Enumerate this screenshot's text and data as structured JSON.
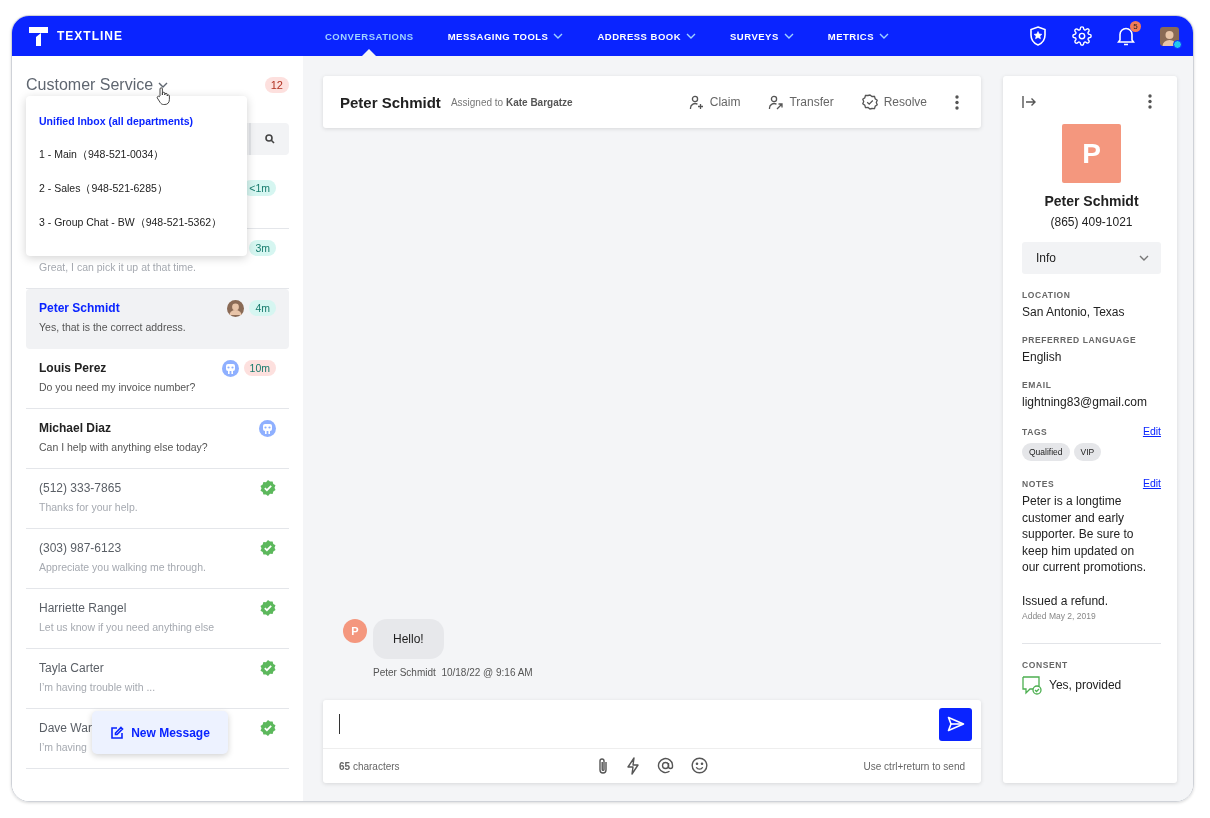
{
  "brand": "TEXTLINE",
  "nav": [
    {
      "label": "CONVERSATIONS",
      "selected": true,
      "has_menu": false
    },
    {
      "label": "MESSAGING TOOLS",
      "selected": false,
      "has_menu": true
    },
    {
      "label": "ADDRESS BOOK",
      "selected": false,
      "has_menu": true
    },
    {
      "label": "SURVEYS",
      "selected": false,
      "has_menu": true
    },
    {
      "label": "METRICS",
      "selected": false,
      "has_menu": true
    }
  ],
  "notifications": {
    "count": "5"
  },
  "user": {
    "online": true
  },
  "inbox": {
    "title": "Customer Service",
    "unread_count": "12",
    "menu": [
      {
        "label": "Unified Inbox (all departments)",
        "selected": true
      },
      {
        "label": "1 - Main（948-521-0034）",
        "selected": false
      },
      {
        "label": "2 - Sales（948-521-6285）",
        "selected": false
      },
      {
        "label": "3 - Group Chat - BW（948-521-5362）",
        "selected": false
      }
    ]
  },
  "conversations": [
    {
      "time": "<1m",
      "color": "#d6f6f1",
      "selected": false
    },
    {
      "preview": "Great, I can pick it up at that time.",
      "time": "3m",
      "color": "#d6f6f1",
      "unread": false,
      "selected": false
    },
    {
      "name": "Peter Schmidt",
      "preview": "Yes, that is the correct address.",
      "kind": "avatar",
      "time": "4m",
      "color": "#d6f6f1",
      "unread": true,
      "selected": true
    },
    {
      "name": "Louis Perez",
      "preview": "Do you need my invoice number?",
      "kind": "bot",
      "time": "10m",
      "color": "#fde0de",
      "unread": true,
      "selected": false
    },
    {
      "name": "Michael Diaz",
      "preview": "Can I help with anything else today?",
      "kind": "bot",
      "unread": true,
      "selected": false
    },
    {
      "name": "(512) 333-7865",
      "preview": "Thanks for your help.",
      "kind": "check",
      "unread": false,
      "selected": false
    },
    {
      "name": "(303) 987-6123",
      "preview": "Appreciate you walking me through.",
      "kind": "check",
      "unread": false,
      "selected": false
    },
    {
      "name": "Harriette Rangel",
      "preview": "Let us know if you need anything else",
      "kind": "check",
      "unread": false,
      "selected": false
    },
    {
      "name": "Tayla Carter",
      "preview": "I’m having trouble with ...",
      "kind": "check",
      "unread": false,
      "selected": false
    },
    {
      "name": "Dave War",
      "preview": "I’m having",
      "kind": "check",
      "unread": false,
      "selected": false
    }
  ],
  "new_message": "New Message",
  "conversation": {
    "name": "Peter Schmidt",
    "assigned_prefix": "Assigned to",
    "assignee": "Kate Bargatze",
    "actions": [
      {
        "label": "Claim",
        "kind": "claim"
      },
      {
        "label": "Transfer",
        "kind": "transfer"
      },
      {
        "label": "Resolve",
        "kind": "resolve"
      }
    ]
  },
  "messages": [
    {
      "initial": "P",
      "text": "Hello!",
      "author": "Peter Schmidt",
      "time": "10/18/22 @ 9:16 AM"
    }
  ],
  "composer": {
    "count": "**65** characters",
    "hint": "Use ctrl+return to send"
  },
  "contact": {
    "initial": "P",
    "name": "Peter Schmidt",
    "phone": "(865) 409-1021",
    "section": "Info",
    "fields": [
      {
        "label": "LOCATION",
        "value": "San Antonio, Texas"
      },
      {
        "label": "PREFERRED LANGUAGE",
        "value": "English"
      },
      {
        "label": "EMAIL",
        "value": "lightning83@gmail.com"
      }
    ],
    "tags": {
      "label": "TAGS",
      "edit": "Edit",
      "items": [
        "Qualified",
        "VIP"
      ]
    },
    "notes": {
      "label": "NOTES",
      "edit": "Edit",
      "text": "Peter is a longtime customer and early supporter. Be sure to keep him updated on our current promotions.",
      "extra": "Issued a refund.",
      "added": "Added May 2, 2019"
    },
    "consent": {
      "label": "CONSENT",
      "value": "Yes, provided"
    }
  }
}
